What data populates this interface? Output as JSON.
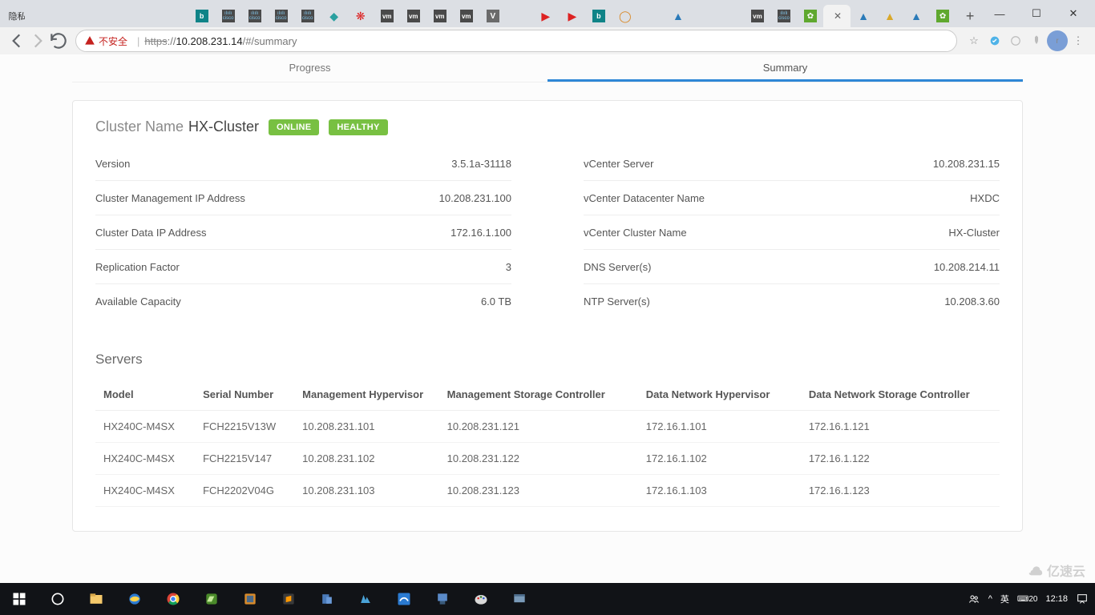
{
  "browser": {
    "tab_favicons": [
      "label:隐私",
      "page",
      "page",
      "page",
      "page",
      "page",
      "page",
      "bing",
      "cisco",
      "cisco",
      "cisco",
      "cisco",
      "teal",
      "huawei",
      "vm",
      "vm",
      "vm",
      "vm",
      "v",
      "page",
      "yt",
      "yt",
      "bing",
      "orange",
      "page",
      "tri-b",
      "page",
      "page",
      "vm",
      "cisco",
      "vsph",
      "page-active",
      "tri-b",
      "tri-y",
      "tri-b",
      "vsph"
    ],
    "active_tab_index": 31,
    "url_warn": "不安全",
    "url_scheme": "https",
    "url_host": "10.208.231.14",
    "url_path": "/#/summary",
    "avatar_letter": "r"
  },
  "page": {
    "tabs": {
      "progress": "Progress",
      "summary": "Summary",
      "active": "summary"
    },
    "cluster": {
      "name_label": "Cluster Name",
      "name_value": "HX-Cluster",
      "badges": [
        "ONLINE",
        "HEALTHY"
      ],
      "left": [
        {
          "k": "Version",
          "v": "3.5.1a-31118"
        },
        {
          "k": "Cluster Management IP Address",
          "v": "10.208.231.100"
        },
        {
          "k": "Cluster Data IP Address",
          "v": "172.16.1.100"
        },
        {
          "k": "Replication Factor",
          "v": "3"
        },
        {
          "k": "Available Capacity",
          "v": "6.0 TB"
        }
      ],
      "right": [
        {
          "k": "vCenter Server",
          "v": "10.208.231.15"
        },
        {
          "k": "vCenter Datacenter Name",
          "v": "HXDC"
        },
        {
          "k": "vCenter Cluster Name",
          "v": "HX-Cluster"
        },
        {
          "k": "DNS Server(s)",
          "v": "10.208.214.11"
        },
        {
          "k": "NTP Server(s)",
          "v": "10.208.3.60"
        }
      ]
    },
    "servers": {
      "title": "Servers",
      "headers": [
        "Model",
        "Serial Number",
        "Management Hypervisor",
        "Management Storage Controller",
        "Data Network Hypervisor",
        "Data Network Storage Controller"
      ],
      "rows": [
        [
          "HX240C-M4SX",
          "FCH2215V13W",
          "10.208.231.101",
          "10.208.231.121",
          "172.16.1.101",
          "172.16.1.121"
        ],
        [
          "HX240C-M4SX",
          "FCH2215V147",
          "10.208.231.102",
          "10.208.231.122",
          "172.16.1.102",
          "172.16.1.122"
        ],
        [
          "HX240C-M4SX",
          "FCH2202V04G",
          "10.208.231.103",
          "10.208.231.123",
          "172.16.1.103",
          "172.16.1.123"
        ]
      ]
    }
  },
  "taskbar": {
    "ime_lang": "英",
    "ime_half": "20",
    "time": "12:18",
    "date": ""
  },
  "watermark": "亿速云"
}
